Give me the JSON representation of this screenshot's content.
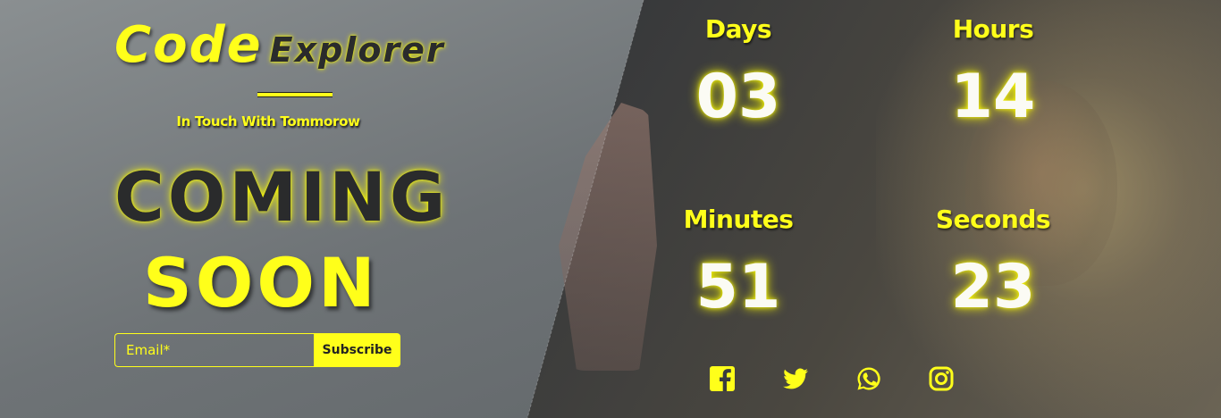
{
  "brand": {
    "code": "Code",
    "explorer": "Explorer",
    "tagline": "In Touch With Tommorow"
  },
  "headline": {
    "line1": "COMING",
    "line2": "SOON"
  },
  "subscribe": {
    "email_placeholder": "Email*",
    "button_label": "Subscribe"
  },
  "countdown": {
    "days": {
      "label": "Days",
      "value": "03"
    },
    "hours": {
      "label": "Hours",
      "value": "14"
    },
    "minutes": {
      "label": "Minutes",
      "value": "51"
    },
    "seconds": {
      "label": "Seconds",
      "value": "23"
    }
  },
  "social": [
    {
      "icon": "facebook-icon"
    },
    {
      "icon": "twitter-icon"
    },
    {
      "icon": "whatsapp-icon"
    },
    {
      "icon": "instagram-icon"
    }
  ],
  "colors": {
    "accent": "#ffff1a",
    "dark_text": "#2a2b2c",
    "digits": "#fbfbf4"
  }
}
